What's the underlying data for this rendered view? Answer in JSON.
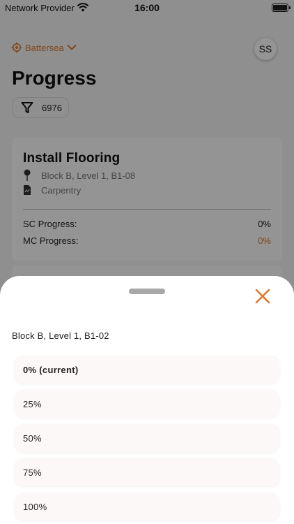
{
  "status_bar": {
    "provider": "Network Provider",
    "time": "16:00"
  },
  "header": {
    "location": "Battersea",
    "avatar_initials": "SS",
    "title": "Progress",
    "filter_count": "6976"
  },
  "task_card": {
    "title": "Install Flooring",
    "location": "Block B, Level 1, B1-08",
    "trade": "Carpentry",
    "sc_label": "SC Progress:",
    "sc_value": "0%",
    "mc_label": "MC Progress:",
    "mc_value": "0%"
  },
  "sheet": {
    "location": "Block B, Level 1, B1-02",
    "options": [
      "0% (current)",
      "25%",
      "50%",
      "75%",
      "100%"
    ]
  },
  "colors": {
    "accent": "#e07a2e",
    "overlay": "rgba(0,0,0,0.42)"
  }
}
